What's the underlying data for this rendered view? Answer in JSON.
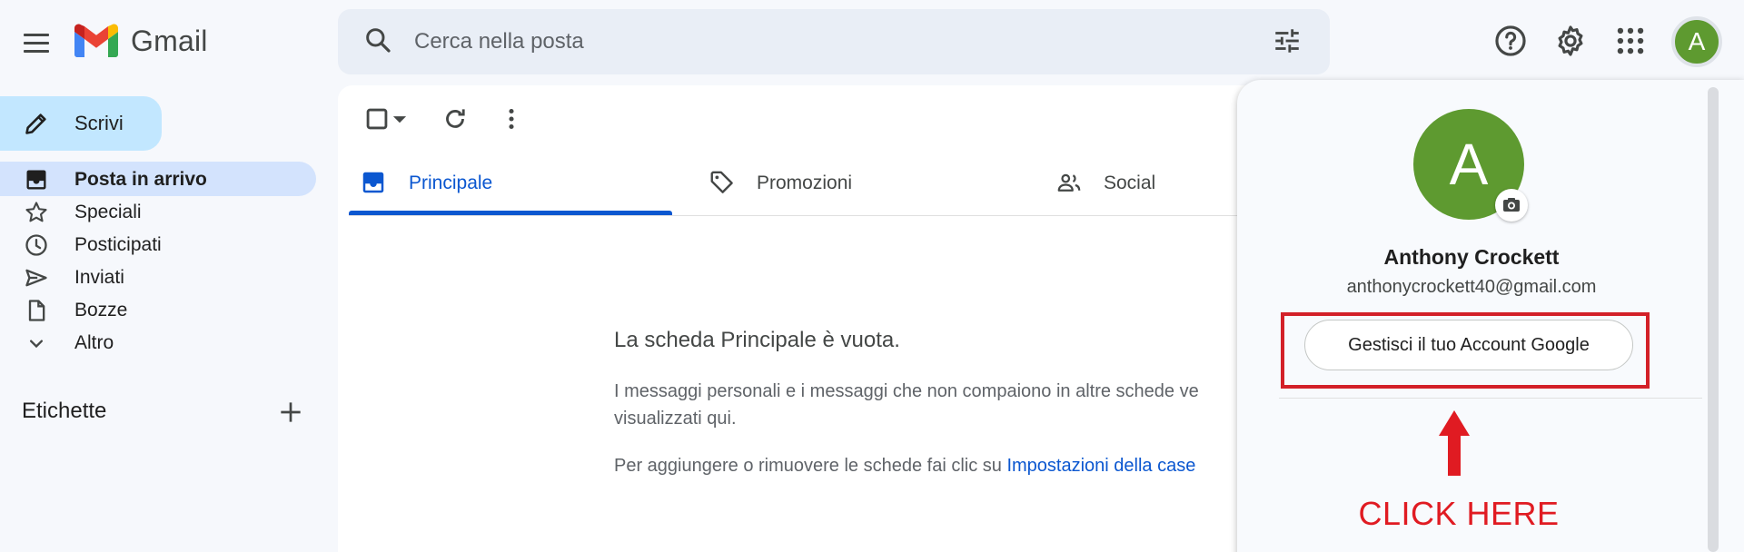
{
  "header": {
    "app_name": "Gmail",
    "search": {
      "placeholder": "Cerca nella posta",
      "value": ""
    },
    "avatar_initial": "A"
  },
  "compose": {
    "label": "Scrivi"
  },
  "sidebar": {
    "items": [
      {
        "label": "Posta in arrivo",
        "icon": "inbox-icon",
        "active": true
      },
      {
        "label": "Speciali",
        "icon": "star-icon"
      },
      {
        "label": "Posticipati",
        "icon": "clock-icon"
      },
      {
        "label": "Inviati",
        "icon": "send-icon"
      },
      {
        "label": "Bozze",
        "icon": "draft-icon"
      },
      {
        "label": "Altro",
        "icon": "chevron-down-icon"
      }
    ],
    "labels_title": "Etichette"
  },
  "tabs": [
    {
      "label": "Principale",
      "icon": "inbox-icon",
      "active": true
    },
    {
      "label": "Promozioni",
      "icon": "tag-icon"
    },
    {
      "label": "Social",
      "icon": "people-icon"
    }
  ],
  "empty_state": {
    "title": "La scheda Principale è vuota.",
    "line1": "I messaggi personali e i messaggi che non compaiono in altre schede ve",
    "line2": "visualizzati qui.",
    "line3_prefix": "Per aggiungere o rimuovere le schede fai clic su ",
    "line3_link": "Impostazioni della case"
  },
  "account_popup": {
    "avatar_initial": "A",
    "name": "Anthony Crockett",
    "email": "anthonycrockett40@gmail.com",
    "manage_button": "Gestisci il tuo Account Google"
  },
  "annotation": {
    "text": "CLICK HERE",
    "color": "#e01b22"
  },
  "colors": {
    "accent_blue": "#0b57d0",
    "compose_bg": "#c2e7ff",
    "active_nav_bg": "#d3e3fd",
    "avatar_green": "#5e9a30",
    "annotation_red": "#e01b22"
  }
}
